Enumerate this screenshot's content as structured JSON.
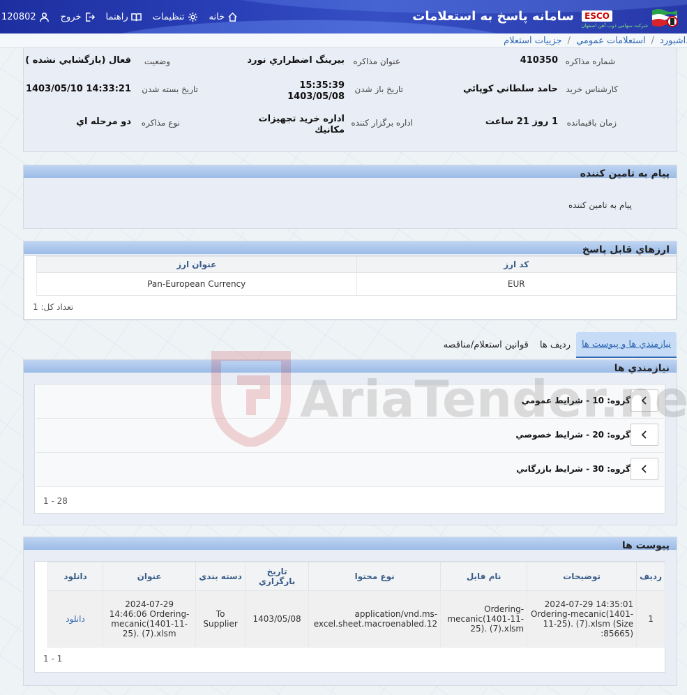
{
  "header": {
    "title": "سامانه پاسخ به استعلامات",
    "logo_text": "ESCO",
    "logo_subtitle": "شرکت سهامی ذوب آهن اصفهان",
    "nav": [
      {
        "label": "120802",
        "icon": "user-icon"
      },
      {
        "label": "خروج",
        "icon": "logout-icon"
      },
      {
        "label": "راهنما",
        "icon": "book-icon"
      },
      {
        "label": "تنظیمات",
        "icon": "gear-icon"
      },
      {
        "label": "خانه",
        "icon": "home-icon"
      }
    ]
  },
  "breadcrumb": [
    "داشبورد",
    "استعلامات عمومي",
    "جزييات استعلام"
  ],
  "details": {
    "inquiry_no_label": "شماره مذاكره",
    "inquiry_no": "410350",
    "subject_label": "عنوان مذاكره",
    "subject": "بيرينگ اضطراري نورد",
    "status_label": "وضعيت",
    "status": "فعال (بازگشايي نشده )",
    "expert_label": "كارشناس خريد",
    "expert": "حامد سلطاني كوپائي",
    "open_date_label": "تاريخ باز شدن",
    "open_time": "15:35:39",
    "open_date": "1403/05/08",
    "close_date_label": "تاريخ بسته شدن",
    "close_date": "1403/05/10 14:33:21",
    "remaining_label": "زمان باقيمانده",
    "remaining": "1 روز 21 ساعت",
    "dept_label": "اداره برگزار كننده",
    "dept_line1": "اداره خريد تجهيزات",
    "dept_line2": "مكانيك",
    "type_label": "نوع مذاكره",
    "type": "دو مرحله اي"
  },
  "message_panel": {
    "title": "پيام به تامين كننده",
    "body": "پيام به تامين كننده"
  },
  "currency_panel": {
    "title": "ارزهاي قابل پاسخ",
    "columns": [
      "كد ارز",
      "عنوان ارز"
    ],
    "rows": [
      [
        "EUR",
        "Pan-European Currency"
      ]
    ],
    "count_label": "تعداد كل: 1"
  },
  "tabs": [
    "نيازمندي ها و پيوست ها",
    "رديف ها",
    "قوانين استعلام/مناقصه"
  ],
  "requirements": {
    "title": "نيازمندي ها",
    "groups": [
      {
        "prefix": "گروه: 10",
        "name": "شرايط عمومي"
      },
      {
        "prefix": "گروه: 20",
        "name": "شرايط خصوصي"
      },
      {
        "prefix": "گروه: 30",
        "name": "شرايط بازرگاني"
      }
    ],
    "pager": "1 - 28"
  },
  "attachments": {
    "title": "پيوست ها",
    "columns": [
      "رديف",
      "توضيحات",
      "نام فايل",
      "نوع محتوا",
      "تاريخ بارگزاري",
      "دسته بندي",
      "عنوان",
      "دانلود"
    ],
    "rows": [
      [
        "1",
        "2024-07-29 14:35:01 Ordering-mecanic(1401-11-25). (7).xlsm (Size :85665)",
        "Ordering-mecanic(1401-11-25). (7).xlsm",
        "application/vnd.ms-excel.sheet.macroenabled.12",
        "1403/05/08",
        "To Supplier",
        "2024-07-29 14:46:06 Ordering-mecanic(1401-11-25). (7).xlsm",
        "دانلود"
      ]
    ],
    "pager": "1 - 1"
  },
  "watermark": "AriaTender.neT",
  "colors": {
    "header": "#2a40b8",
    "accent": "#2e67b5",
    "panel_head": "#9bbbe6"
  }
}
